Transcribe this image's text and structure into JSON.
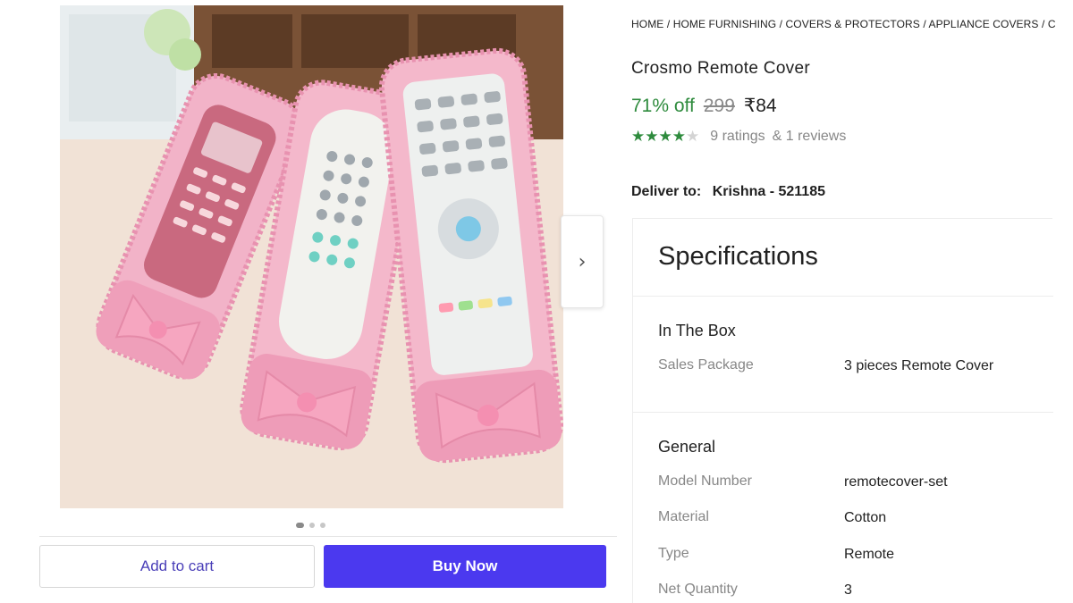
{
  "breadcrumb": {
    "items": [
      "HOME",
      "HOME FURNISHING",
      "COVERS & PROTECTORS",
      "APPLIANCE COVERS",
      "C"
    ]
  },
  "product": {
    "title": "Crosmo Remote  Cover",
    "discount": "71% off",
    "mrp": "299",
    "price": "₹84",
    "rating": {
      "stars": 4,
      "max": 5,
      "ratings_text": "9 ratings",
      "reviews_text": "& 1 reviews"
    }
  },
  "delivery": {
    "label": "Deliver to:",
    "value": "Krishna - 521185"
  },
  "gallery": {
    "active_index": 0,
    "count": 3,
    "next_arrow": "›"
  },
  "actions": {
    "add_to_cart": "Add to cart",
    "buy_now": "Buy Now"
  },
  "specifications": {
    "title": "Specifications",
    "sections": [
      {
        "name": "In The Box",
        "rows": [
          {
            "key": "Sales Package",
            "value": "3 pieces Remote Cover"
          }
        ]
      },
      {
        "name": "General",
        "rows": [
          {
            "key": "Model Number",
            "value": "remotecover-set"
          },
          {
            "key": "Material",
            "value": "Cotton"
          },
          {
            "key": "Type",
            "value": "Remote"
          },
          {
            "key": "Net Quantity",
            "value": "3"
          }
        ]
      }
    ]
  },
  "colors": {
    "discount_green": "#2e8b3d",
    "buy_button": "#4b39ef",
    "cart_text": "#4a3fb8",
    "star_on": "#2e8b3d",
    "star_off": "#d4d4d4"
  }
}
